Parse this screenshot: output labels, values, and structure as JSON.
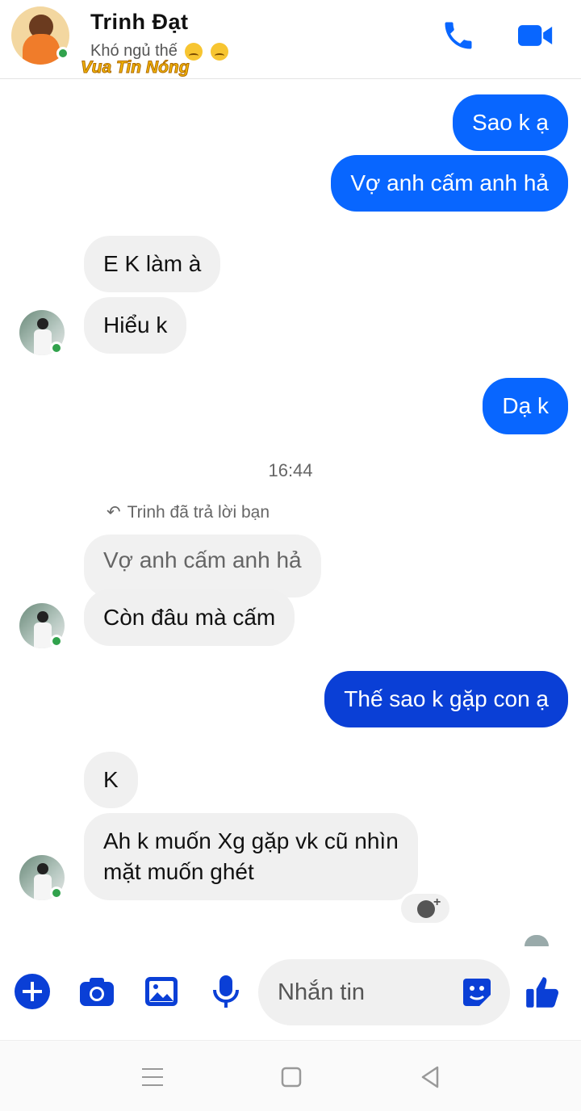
{
  "header": {
    "contact_name": "Trinh Đạt",
    "status_text": "Khó ngủ thế",
    "watermark": "Vua Tin Nóng",
    "call_icon": "phone-icon",
    "video_icon": "video-camera-icon"
  },
  "colors": {
    "accent": "#0866ff",
    "accent_dark": "#0a3fd6",
    "incoming_bg": "#f0f0f0",
    "online": "#31a24c"
  },
  "messages": [
    {
      "dir": "out",
      "text": "Sao k ạ"
    },
    {
      "dir": "out",
      "text": "Vợ anh cấm anh hả"
    },
    {
      "dir": "in",
      "text": "E K làm à"
    },
    {
      "dir": "in",
      "text": "Hiểu k"
    },
    {
      "dir": "out",
      "text": "Dạ k"
    },
    {
      "dir": "in",
      "text": "Còn đâu mà cấm"
    },
    {
      "dir": "out",
      "text": "Thế sao k gặp con ạ"
    },
    {
      "dir": "in",
      "text": "K"
    },
    {
      "dir": "in",
      "text_line1": "Ah k muốn Xg gặp vk cũ nhìn",
      "text_line2": "mặt muốn ghét"
    }
  ],
  "timestamp": "16:44",
  "reply": {
    "note": "Trinh đã trả lời bạn",
    "quoted": "Vợ anh cấm anh hả"
  },
  "composer": {
    "placeholder": "Nhắn tin",
    "icons": [
      "plus-icon",
      "camera-icon",
      "gallery-icon",
      "microphone-icon",
      "sticker-icon",
      "thumbs-up-icon"
    ]
  },
  "navbar": {
    "icons": [
      "menu-icon",
      "home-square-icon",
      "back-triangle-icon"
    ]
  }
}
